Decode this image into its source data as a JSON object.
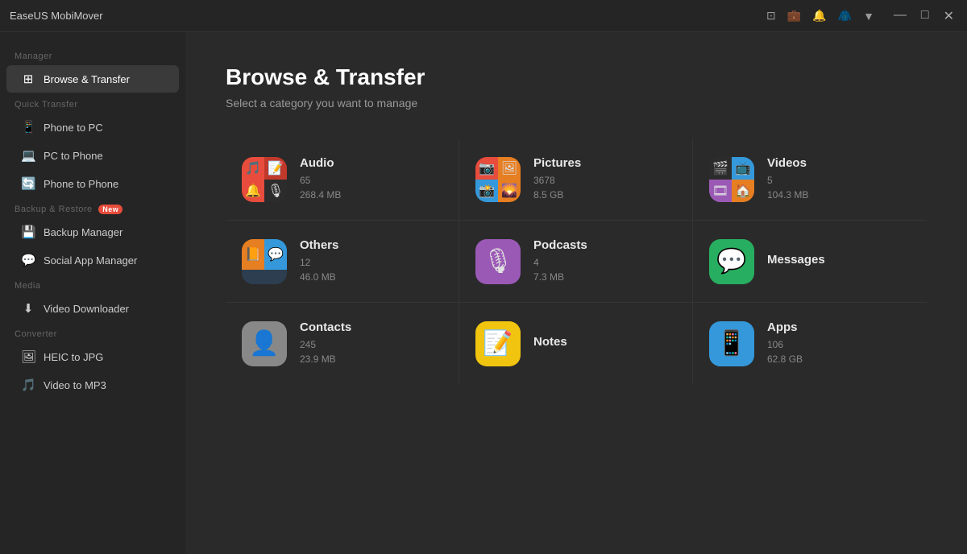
{
  "app": {
    "title": "EaseUS MobiMover"
  },
  "titlebar": {
    "icons": [
      "device-icon",
      "transfer-icon",
      "bell-icon",
      "hanger-icon",
      "dropdown-icon"
    ],
    "min": "—",
    "max": "□",
    "close": "✕"
  },
  "sidebar": {
    "manager_label": "Manager",
    "quick_transfer_label": "Quick Transfer",
    "backup_label": "Backup & Restore",
    "media_label": "Media",
    "converter_label": "Converter",
    "items": [
      {
        "id": "browse-transfer",
        "label": "Browse & Transfer",
        "icon": "⊞",
        "active": true
      },
      {
        "id": "phone-to-pc",
        "label": "Phone to PC",
        "icon": "📱"
      },
      {
        "id": "pc-to-phone",
        "label": "PC to Phone",
        "icon": "💻"
      },
      {
        "id": "phone-to-phone",
        "label": "Phone to Phone",
        "icon": "🔄"
      },
      {
        "id": "backup-manager",
        "label": "Backup Manager",
        "icon": "💾"
      },
      {
        "id": "social-app-manager",
        "label": "Social App Manager",
        "icon": "💬"
      },
      {
        "id": "video-downloader",
        "label": "Video Downloader",
        "icon": "⬇"
      },
      {
        "id": "heic-to-jpg",
        "label": "HEIC to JPG",
        "icon": "🖼"
      },
      {
        "id": "video-to-mp3",
        "label": "Video to MP3",
        "icon": "🎵"
      }
    ]
  },
  "main": {
    "title": "Browse & Transfer",
    "subtitle": "Select a category you want to manage",
    "categories": [
      {
        "id": "audio",
        "name": "Audio",
        "count": "65",
        "size": "268.4 MB",
        "icon_type": "grid"
      },
      {
        "id": "pictures",
        "name": "Pictures",
        "count": "3678",
        "size": "8.5 GB",
        "icon_type": "grid"
      },
      {
        "id": "videos",
        "name": "Videos",
        "count": "5",
        "size": "104.3 MB",
        "icon_type": "grid"
      },
      {
        "id": "others",
        "name": "Others",
        "count": "12",
        "size": "46.0 MB",
        "icon_type": "grid"
      },
      {
        "id": "podcasts",
        "name": "Podcasts",
        "count": "4",
        "size": "7.3 MB",
        "icon_type": "single"
      },
      {
        "id": "messages",
        "name": "Messages",
        "count": "",
        "size": "",
        "icon_type": "single"
      },
      {
        "id": "contacts",
        "name": "Contacts",
        "count": "245",
        "size": "23.9 MB",
        "icon_type": "single"
      },
      {
        "id": "notes",
        "name": "Notes",
        "count": "",
        "size": "",
        "icon_type": "single"
      },
      {
        "id": "apps",
        "name": "Apps",
        "count": "106",
        "size": "62.8 GB",
        "icon_type": "single"
      }
    ]
  }
}
